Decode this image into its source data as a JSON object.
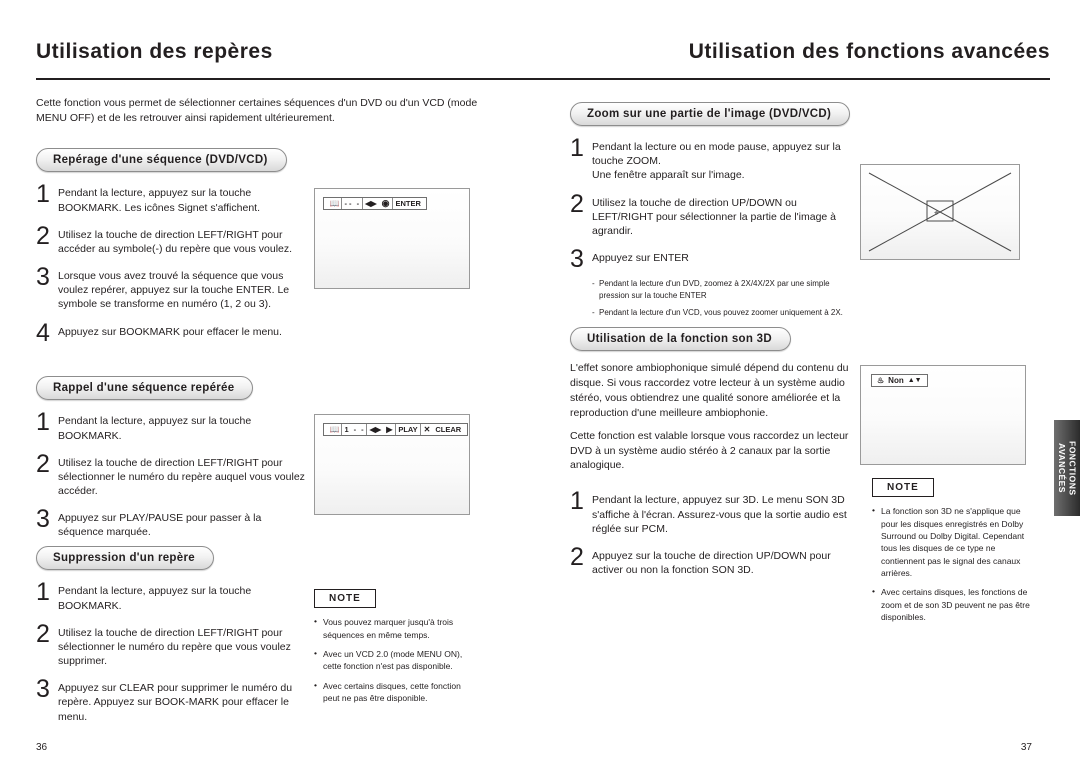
{
  "header": {
    "left_title": "Utilisation des repères",
    "right_title": "Utilisation des fonctions avancées"
  },
  "left": {
    "intro": "Cette fonction vous permet de sélectionner certaines séquences d'un DVD ou d'un VCD (mode MENU OFF) et de les retrouver ainsi rapidement ultérieurement.",
    "section1": {
      "title": "Repérage d'une séquence (DVD/VCD)",
      "steps": [
        {
          "num": "1",
          "text": "Pendant la lecture, appuyez sur la touche BOOKMARK. Les icônes Signet s'affichent."
        },
        {
          "num": "2",
          "text": "Utilisez la touche de direction LEFT/RIGHT pour accéder au symbole(-) du repère que vous voulez."
        },
        {
          "num": "3",
          "text": "Lorsque vous avez trouvé la séquence que vous voulez repérer, appuyez sur la touche ENTER. Le symbole se transforme en numéro (1, 2 ou 3)."
        },
        {
          "num": "4",
          "text": "Appuyez sur BOOKMARK pour effacer le menu."
        }
      ],
      "osd": [
        "- -",
        "-",
        "ENTER"
      ]
    },
    "section2": {
      "title": "Rappel d'une séquence repérée",
      "steps": [
        {
          "num": "1",
          "text": "Pendant la lecture, appuyez sur la touche BOOKMARK."
        },
        {
          "num": "2",
          "text": "Utilisez la touche de direction LEFT/RIGHT pour sélectionner le numéro du repère auquel vous voulez accéder."
        },
        {
          "num": "3",
          "text": "Appuyez sur PLAY/PAUSE pour passer à la séquence marquée."
        }
      ],
      "osd": [
        "1",
        "-",
        "-",
        "PLAY",
        "CLEAR"
      ]
    },
    "section3": {
      "title": "Suppression d'un repère",
      "steps": [
        {
          "num": "1",
          "text": "Pendant la lecture, appuyez sur la touche BOOKMARK."
        },
        {
          "num": "2",
          "text": "Utilisez la touche de direction LEFT/RIGHT pour sélectionner le numéro du repère que vous voulez supprimer."
        },
        {
          "num": "3",
          "text": "Appuyez sur CLEAR pour supprimer le numéro du repère. Appuyez sur BOOK-MARK pour effacer le menu."
        }
      ]
    },
    "note": {
      "title": "NOTE",
      "items": [
        "Vous pouvez marquer jusqu'à trois séquences en même temps.",
        "Avec un VCD 2.0 (mode MENU ON), cette fonction n'est pas disponible.",
        "Avec certains disques, cette fonction peut ne pas être disponible."
      ]
    },
    "page_number": "36"
  },
  "right": {
    "section1": {
      "title": "Zoom sur une partie de l'image (DVD/VCD)",
      "steps": [
        {
          "num": "1",
          "text": "Pendant la lecture ou en mode pause, appuyez sur la touche ZOOM.\nUne fenêtre apparaît sur l'image."
        },
        {
          "num": "2",
          "text": "Utilisez la touche de direction UP/DOWN ou LEFT/RIGHT pour sélectionner la partie de l'image à agrandir."
        },
        {
          "num": "3",
          "text": "Appuyez sur ENTER"
        }
      ],
      "subnotes": [
        "Pendant la lecture d'un DVD, zoomez à 2X/4X/2X par une simple pression sur la touche ENTER",
        "Pendant la lecture d'un VCD, vous pouvez zoomer uniquement à 2X."
      ]
    },
    "section2": {
      "title": "Utilisation de la fonction son 3D",
      "paragraphs": [
        "L'effet sonore ambiophonique simulé dépend du contenu du disque. Si vous raccordez votre lecteur à un système audio stéréo, vous obtiendrez une qualité sonore améliorée et la reproduction d'une meilleure ambiophonie.",
        "Cette fonction est valable lorsque vous raccordez un lecteur DVD à un système audio stéréo à 2 canaux par la sortie analogique."
      ],
      "badge": "Non",
      "steps": [
        {
          "num": "1",
          "text": "Pendant la lecture, appuyez sur 3D. Le menu SON 3D s'affiche à l'écran. Assurez-vous que la sortie audio est réglée sur PCM."
        },
        {
          "num": "2",
          "text": "Appuyez sur la touche de direction UP/DOWN pour activer ou non la fonction SON 3D."
        }
      ]
    },
    "note": {
      "title": "NOTE",
      "items": [
        "La fonction son 3D ne s'applique que pour les disques enregistrés en Dolby Surround ou Dolby Digital. Cependant tous les disques de ce type ne contiennent pas le signal des canaux arrières.",
        "Avec certains disques, les fonctions de zoom et de son 3D peuvent ne pas être disponibles."
      ]
    },
    "side_tab": "FONCTIONS AVANCÉES",
    "page_number": "37"
  }
}
